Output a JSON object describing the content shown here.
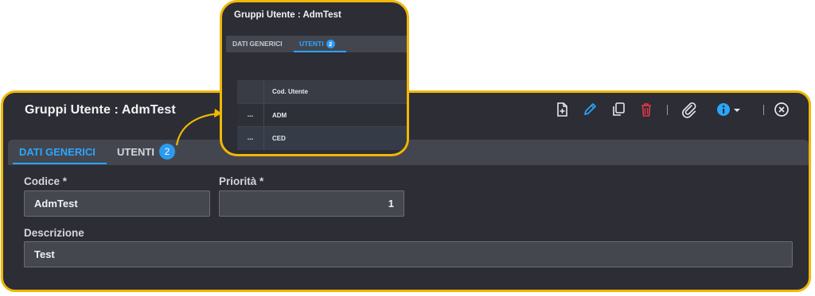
{
  "main": {
    "title": "Gruppi Utente : AdmTest",
    "tabs": [
      {
        "label": "DATI GENERICI",
        "active": true
      },
      {
        "label": "UTENTI",
        "badge": "2",
        "active": false
      }
    ],
    "fields": {
      "codice_label": "Codice *",
      "codice_value": "AdmTest",
      "priorita_label": "Priorità *",
      "priorita_value": "1",
      "descrizione_label": "Descrizione",
      "descrizione_value": "Test"
    },
    "toolbar_icons": [
      "new-document-icon",
      "edit-pencil-icon",
      "copy-icon",
      "delete-trash-icon",
      "attachment-paperclip-icon",
      "info-icon",
      "chevron-down-icon",
      "close-icon"
    ]
  },
  "zoom": {
    "title": "Gruppi Utente : AdmTest",
    "tabs": [
      {
        "label": "DATI GENERICI",
        "active": false
      },
      {
        "label": "UTENTI",
        "badge": "2",
        "active": true
      }
    ],
    "table": {
      "column_header": "Cod. Utente",
      "row_action": "...",
      "rows": [
        {
          "value": "ADM"
        },
        {
          "value": "CED"
        }
      ]
    }
  },
  "colors": {
    "accent": "#2aa6ff",
    "highlight_border": "#f2b705",
    "panel_bg": "#2c2d35",
    "delete_red": "#e53945"
  }
}
